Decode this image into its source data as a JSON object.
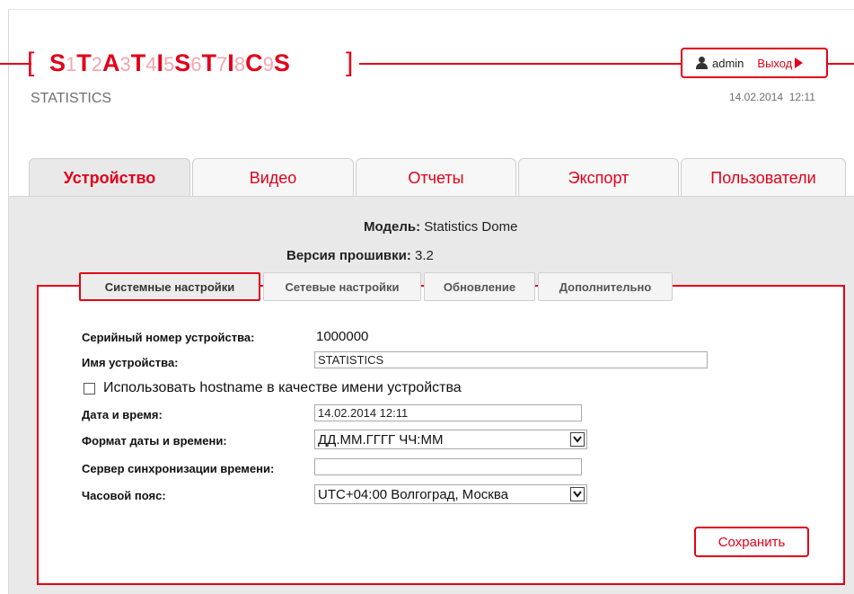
{
  "header": {
    "logo_main": [
      "S",
      "T",
      "A",
      "T",
      "I",
      "S",
      "T",
      "I",
      "C",
      "S"
    ],
    "logo_digits": [
      "1",
      "2",
      "3",
      "4",
      "5",
      "6",
      "7",
      "8",
      "9"
    ],
    "brand_subtitle": "STATISTICS",
    "username": "admin",
    "logout_label": "Выход",
    "datetime": "14.02.2014  12:11"
  },
  "main_tabs": [
    {
      "label": "Устройство",
      "active": true
    },
    {
      "label": "Видео",
      "active": false
    },
    {
      "label": "Отчеты",
      "active": false
    },
    {
      "label": "Экспорт",
      "active": false
    },
    {
      "label": "Пользователи",
      "active": false
    }
  ],
  "device": {
    "model_label": "Модель:",
    "model_value": "Statistics Dome",
    "firmware_label": "Версия прошивки:",
    "firmware_value": "3.2"
  },
  "sub_tabs": [
    {
      "label": "Системные настройки",
      "active": true
    },
    {
      "label": "Сетевые настройки",
      "active": false
    },
    {
      "label": "Обновление",
      "active": false
    },
    {
      "label": "Дополнительно",
      "active": false
    }
  ],
  "form": {
    "serial_label": "Серийный номер устройства:",
    "serial_value": "1000000",
    "name_label": "Имя устройства:",
    "name_value": "STATISTICS",
    "hostname_checkbox_label": "Использовать hostname в качестве имени устройства",
    "hostname_checked": false,
    "datetime_label": "Дата и время:",
    "datetime_value": "14.02.2014 12:11",
    "format_label": "Формат даты и времени:",
    "format_value": "ДД.ММ.ГГГГ ЧЧ:ММ",
    "ntp_label": "Сервер синхронизации времени:",
    "ntp_value": "",
    "timezone_label": "Часовой пояс:",
    "timezone_value": "UTC+04:00 Волгоград, Москва",
    "save_label": "Сохранить"
  },
  "colors": {
    "accent": "#e2001a",
    "accent_light": "#f2a6ae",
    "content_bg": "#e9e9e9"
  }
}
